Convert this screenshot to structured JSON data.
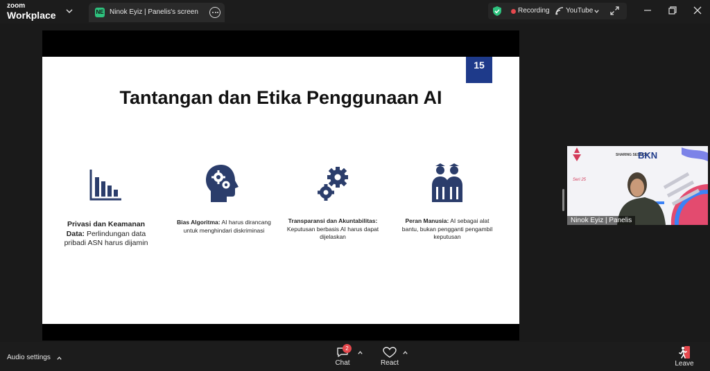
{
  "app": {
    "logo_line1": "zoom",
    "logo_line2": "Workplace"
  },
  "tab": {
    "badge": "NE",
    "title": "Ninok Eyiz | Panelis's screen"
  },
  "status": {
    "recording_label": "Recording",
    "stream_label": "YouTube"
  },
  "slide": {
    "page_number": "15",
    "title": "Tantangan dan Etika Penggunaan AI",
    "items": [
      {
        "heading": "Privasi dan Keamanan Data:",
        "text": " Perlindungan data pribadi ASN harus dijamin"
      },
      {
        "heading": "Bias Algoritma:",
        "text": " AI harus dirancang untuk menghindari diskriminasi"
      },
      {
        "heading": "Transparansi dan Akuntabilitas:",
        "text": " Keputusan berbasis AI harus dapat dijelaskan"
      },
      {
        "heading": "Peran Manusia:",
        "text": " AI sebagai alat bantu, bukan pengganti pengambil keputusan"
      }
    ]
  },
  "video": {
    "participant_name": "Ninok Eyiz | Panelis",
    "banner_top": "SHARING SESSION",
    "banner_brand": "BKN",
    "banner_series": "Seri 25"
  },
  "toolbar": {
    "audio_label": "Audio settings",
    "chat_label": "Chat",
    "chat_badge": "2",
    "react_label": "React",
    "leave_label": "Leave"
  },
  "colors": {
    "slide_icon": "#2b3d6b",
    "page_badge": "#1e3a8a",
    "recording_dot": "#e5484d",
    "secure_shield": "#2ec27e"
  }
}
